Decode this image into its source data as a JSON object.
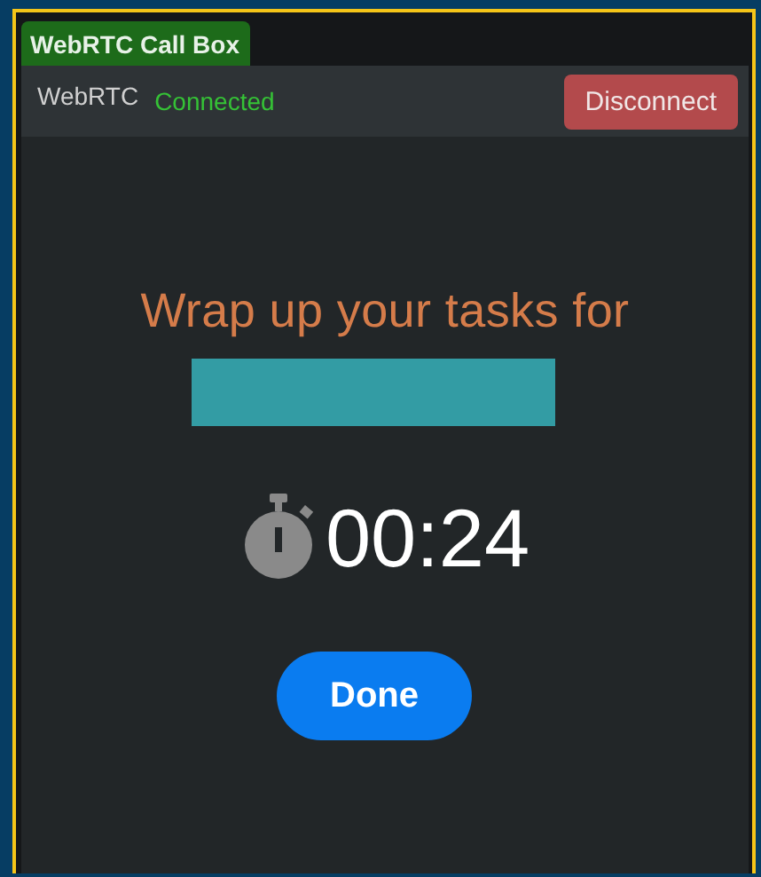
{
  "tab": {
    "label": "WebRTC Call Box",
    "selected": true
  },
  "header": {
    "title": "WebRTC",
    "status": "Connected",
    "button": "Disconnect"
  },
  "prompt": "Wrap up your tasks for",
  "timer": "00:24",
  "button": "Done"
}
